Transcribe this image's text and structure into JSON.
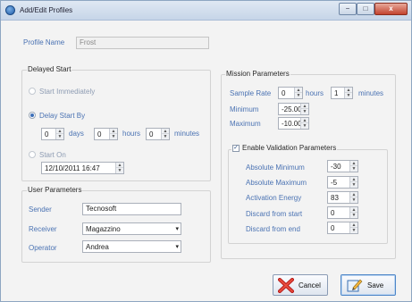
{
  "window": {
    "title": "Add/Edit Profiles",
    "controls": [
      "−",
      "□",
      "x"
    ]
  },
  "profile": {
    "name_label": "Profile Name",
    "name_value": "Frost"
  },
  "delayed_start": {
    "title": "Delayed Start",
    "start_immediately": "Start Immediately",
    "delay_start_by": "Delay Start By",
    "days_value": "0",
    "days_label": "days",
    "hours_value": "0",
    "hours_label": "hours",
    "minutes_value": "0",
    "minutes_label": "minutes",
    "start_on": "Start On",
    "start_on_value": "12/10/2011 16:47",
    "selected": "delay_start_by"
  },
  "user_parameters": {
    "title": "User Parameters",
    "sender_label": "Sender",
    "sender_value": "Tecnosoft",
    "receiver_label": "Receiver",
    "receiver_value": "Magazzino",
    "operator_label": "Operator",
    "operator_value": "Andrea"
  },
  "mission": {
    "title": "Mission Parameters",
    "sample_rate_label": "Sample Rate",
    "sample_hours_value": "0",
    "hours_label": "hours",
    "sample_minutes_value": "1",
    "minutes_label": "minutes",
    "minimum_label": "Minimum",
    "minimum_value": "-25.00",
    "maximum_label": "Maximum",
    "maximum_value": "-10.00"
  },
  "validation": {
    "enabled": true,
    "check_label": "Enable Validation Parameters",
    "absolute_minimum_label": "Absolute Minimum",
    "absolute_minimum_value": "-30",
    "absolute_maximum_label": "Absolute Maximum",
    "absolute_maximum_value": "-5",
    "activation_energy_label": "Activation Energy",
    "activation_energy_value": "83",
    "discard_start_label": "Discard from start",
    "discard_start_value": "0",
    "discard_end_label": "Discard from end",
    "discard_end_value": "0"
  },
  "buttons": {
    "cancel": "Cancel",
    "save": "Save"
  },
  "icons": {
    "app": "app-icon",
    "cancel": "red-x-icon",
    "save": "save-pencil-icon",
    "arrow_up": "▲",
    "arrow_down": "▼",
    "combo_arrow": "▾",
    "check": "✓"
  }
}
